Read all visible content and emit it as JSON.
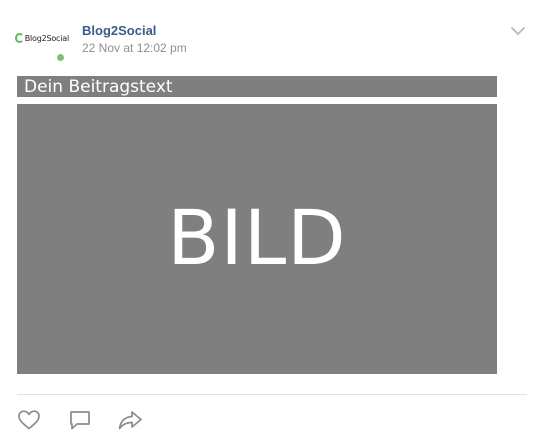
{
  "post": {
    "avatar_logo_text": "Blog2Social",
    "author_name": "Blog2Social",
    "timestamp": "22 Nov at 12:02 pm",
    "caption": "Dein Beitragstext",
    "image_label": "BILD",
    "presence_color": "#7cc26e",
    "image_background": "#7f7f7f"
  },
  "icons": {
    "menu": "chevron-down-icon",
    "like": "heart-icon",
    "comment": "comment-icon",
    "share": "share-arrow-icon"
  }
}
